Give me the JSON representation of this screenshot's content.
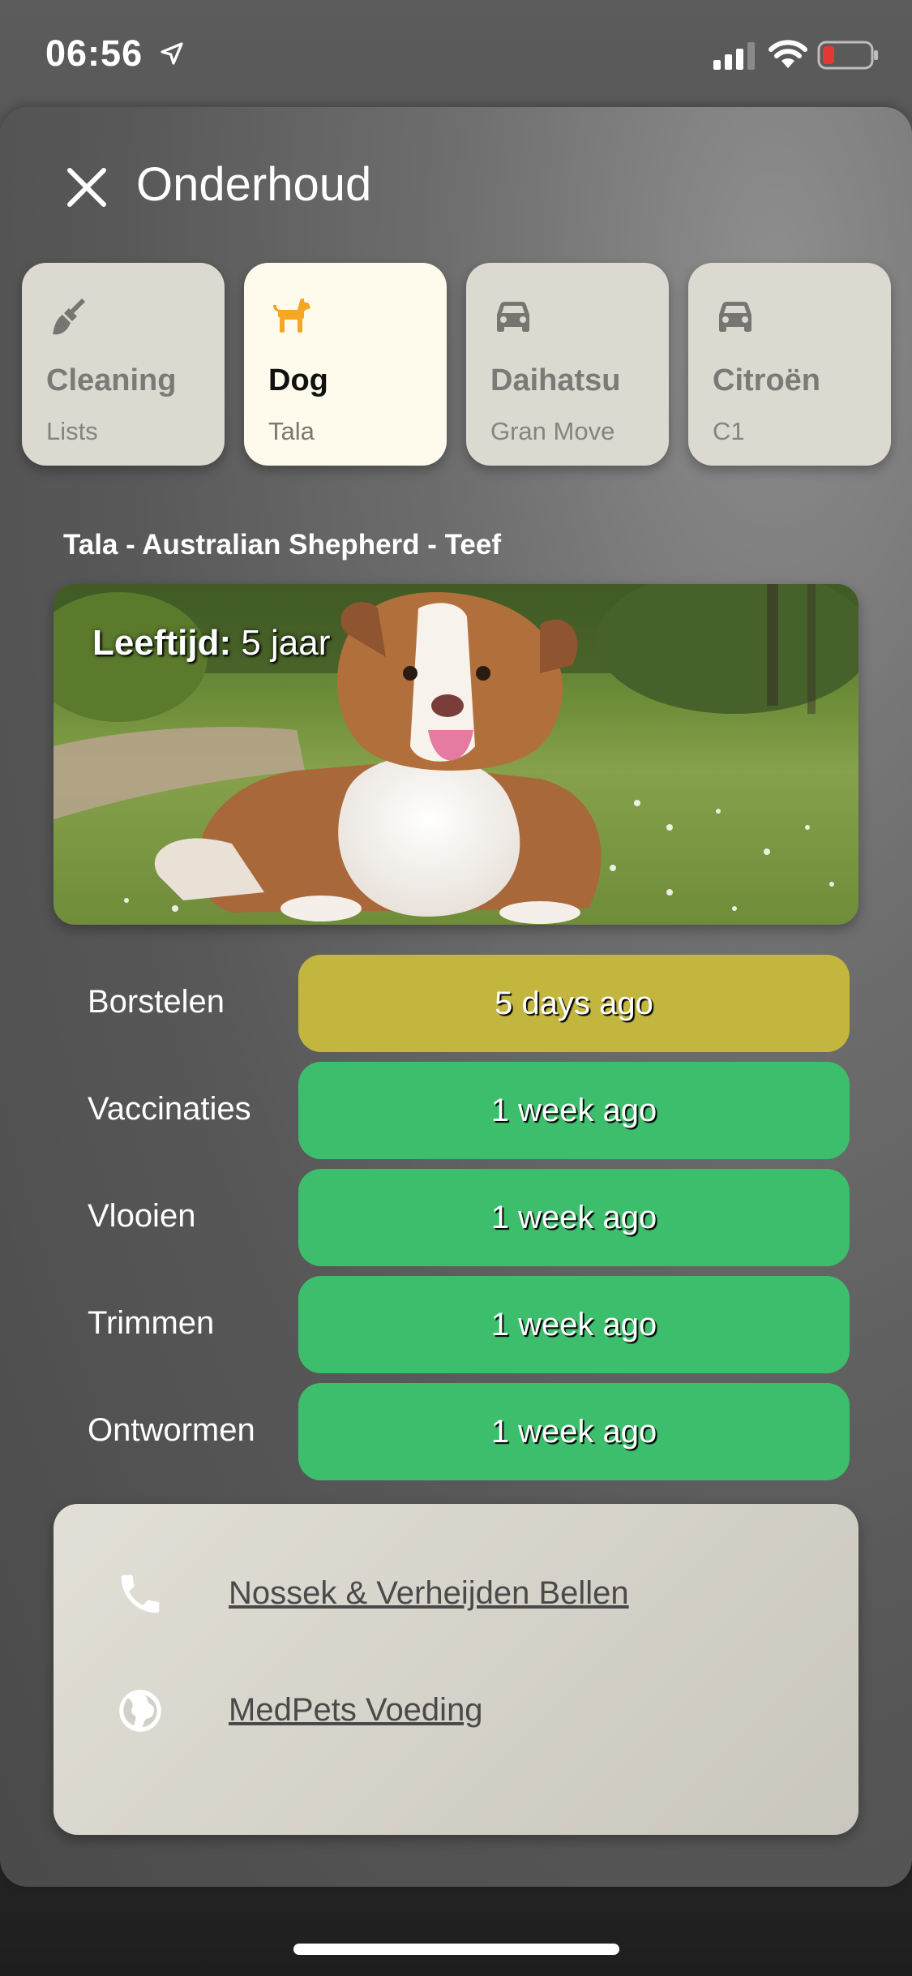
{
  "status_bar": {
    "time": "06:56",
    "icons": [
      "location-arrow-icon",
      "signal-icon",
      "wifi-icon",
      "battery-low-icon"
    ],
    "battery_color": "#e53935"
  },
  "header": {
    "title": "Onderhoud",
    "close_icon": "close-icon"
  },
  "categories": [
    {
      "title": "Cleaning",
      "subtitle": "Lists",
      "icon": "broom-icon",
      "active": false
    },
    {
      "title": "Dog",
      "subtitle": "Tala",
      "icon": "dog-icon",
      "active": true
    },
    {
      "title": "Daihatsu",
      "subtitle": "Gran Move",
      "icon": "car-icon",
      "active": false
    },
    {
      "title": "Citroën",
      "subtitle": "C1",
      "icon": "car-icon",
      "active": false
    }
  ],
  "pet": {
    "heading": "Tala - Australian Shepherd - Teef",
    "age_label": "Leeftijd:",
    "age_value": " 5 jaar",
    "photo": "australian-shepherd-dog-photo"
  },
  "tasks": [
    {
      "label": "Borstelen",
      "status": "5 days ago",
      "color": "#c2b63e"
    },
    {
      "label": "Vaccinaties",
      "status": "1 week ago",
      "color": "#3dbe6c"
    },
    {
      "label": "Vlooien",
      "status": "1 week ago",
      "color": "#3dbe6c"
    },
    {
      "label": "Trimmen",
      "status": "1 week ago",
      "color": "#3dbe6c"
    },
    {
      "label": "Ontwormen",
      "status": "1 week ago",
      "color": "#3dbe6c"
    }
  ],
  "links": [
    {
      "label": "Nossek & Verheijden Bellen",
      "icon": "phone-icon"
    },
    {
      "label": "MedPets Voeding",
      "icon": "globe-icon"
    }
  ],
  "colors": {
    "active_card": "#fefbec",
    "inactive_card": "#dcd9d0",
    "dog_icon": "#f5a623",
    "ok_status": "#3dbe6c",
    "warn_status": "#c2b63e"
  }
}
